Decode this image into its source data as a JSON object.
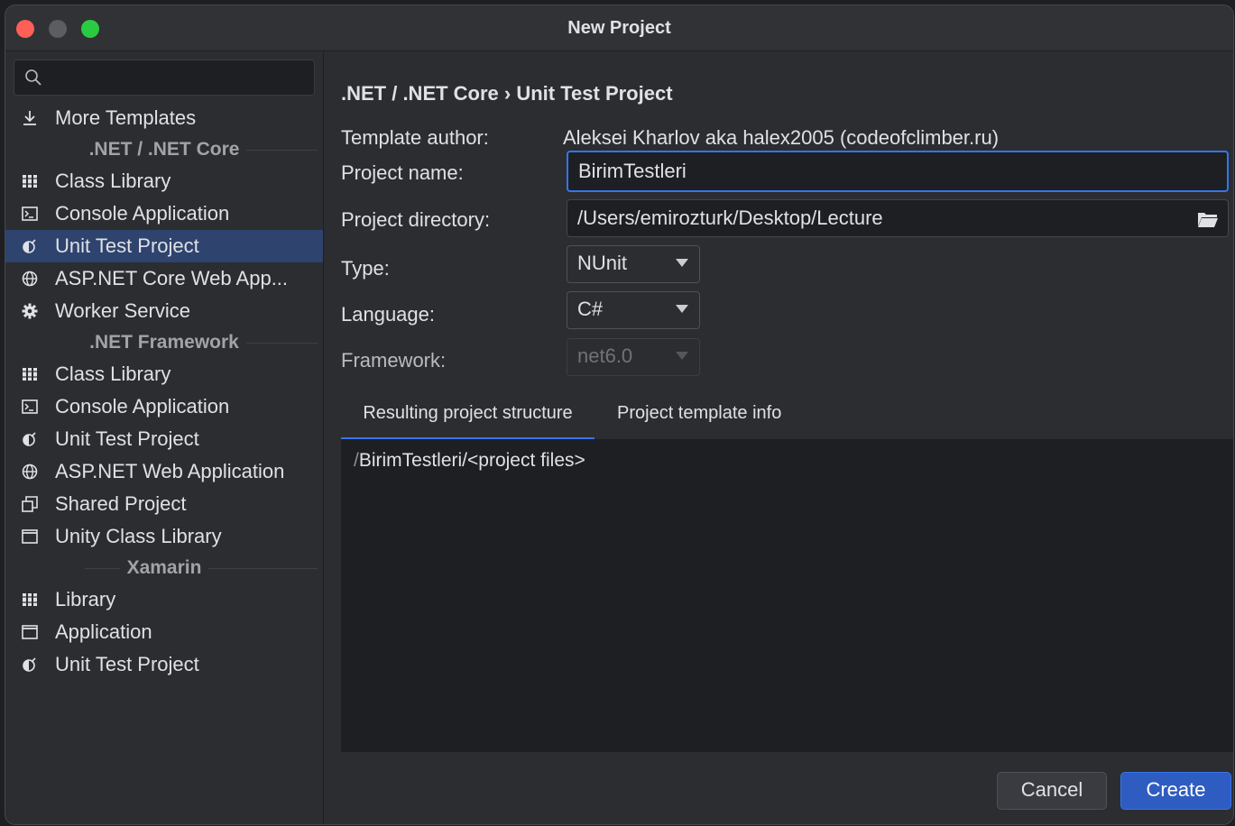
{
  "window": {
    "title": "New Project"
  },
  "sidebar": {
    "search_placeholder": "",
    "entries": [
      {
        "kind": "item",
        "label": "More Templates",
        "icon": "download-icon"
      },
      {
        "kind": "section",
        "label": ".NET / .NET Core"
      },
      {
        "kind": "item",
        "label": "Class Library",
        "icon": "library-icon"
      },
      {
        "kind": "item",
        "label": "Console Application",
        "icon": "console-icon"
      },
      {
        "kind": "item",
        "label": "Unit Test Project",
        "icon": "unit-test-icon",
        "selected": true
      },
      {
        "kind": "item",
        "label": "ASP.NET Core Web App...",
        "icon": "globe-icon"
      },
      {
        "kind": "item",
        "label": "Worker Service",
        "icon": "gear-icon"
      },
      {
        "kind": "section",
        "label": ".NET Framework"
      },
      {
        "kind": "item",
        "label": "Class Library",
        "icon": "library-icon"
      },
      {
        "kind": "item",
        "label": "Console Application",
        "icon": "console-icon"
      },
      {
        "kind": "item",
        "label": "Unit Test Project",
        "icon": "unit-test-icon"
      },
      {
        "kind": "item",
        "label": "ASP.NET Web Application",
        "icon": "globe-icon"
      },
      {
        "kind": "item",
        "label": "Shared Project",
        "icon": "shared-project-icon"
      },
      {
        "kind": "item",
        "label": "Unity Class Library",
        "icon": "window-icon"
      },
      {
        "kind": "section",
        "label": "Xamarin"
      },
      {
        "kind": "item",
        "label": "Library",
        "icon": "library-icon"
      },
      {
        "kind": "item",
        "label": "Application",
        "icon": "window-icon"
      },
      {
        "kind": "item",
        "label": "Unit Test Project",
        "icon": "unit-test-icon"
      }
    ]
  },
  "main": {
    "breadcrumb": ".NET / .NET Core › Unit Test Project",
    "template_author_label": "Template author:",
    "template_author_value": "Aleksei Kharlov aka halex2005 (codeofclimber.ru)",
    "project_name_label": "Project name:",
    "project_name_value": "BirimTestleri",
    "project_directory_label": "Project directory:",
    "project_directory_value": "/Users/emirozturk/Desktop/Lecture",
    "type_label": "Type:",
    "type_value": "NUnit",
    "language_label": "Language:",
    "language_value": "C#",
    "framework_label": "Framework:",
    "framework_value": "net6.0",
    "tabs": [
      "Resulting project structure",
      "Project template info"
    ],
    "structure_slash": "/",
    "structure_path": "BirimTestleri/<project files>"
  },
  "buttons": {
    "cancel": "Cancel",
    "create": "Create"
  },
  "colors": {
    "accent": "#3574f0",
    "selection": "#2e436e",
    "background": "#2b2d30"
  }
}
